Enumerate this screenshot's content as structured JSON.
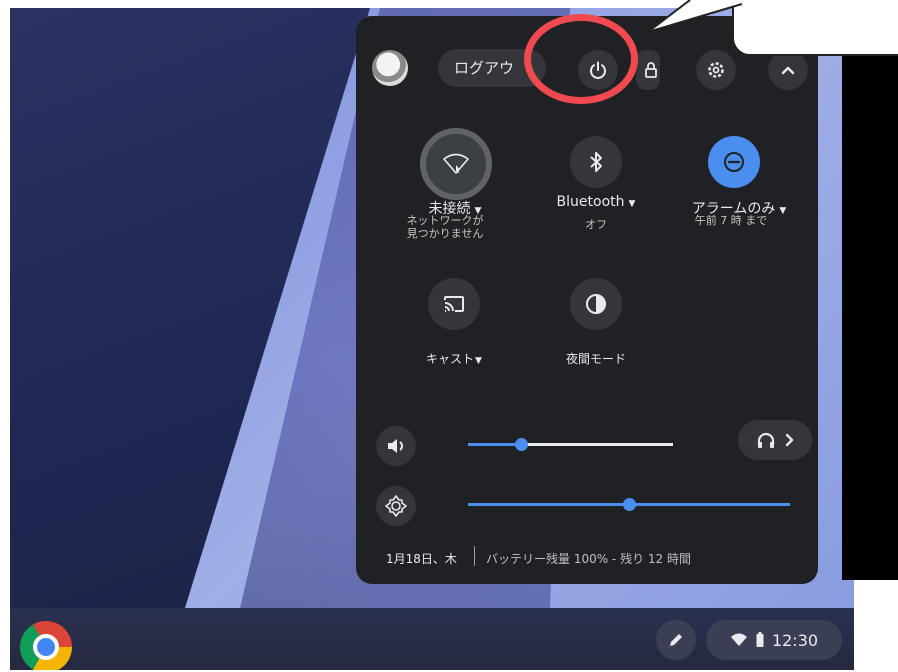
{
  "quick_settings": {
    "logout_label": "ログアウ",
    "network": {
      "label": "未接続",
      "detail": "ネットワークが\n見つかりません"
    },
    "bluetooth": {
      "label": "Bluetooth",
      "detail": "オフ"
    },
    "dnd": {
      "label": "アラームのみ",
      "detail": "午前 7 時 まで"
    },
    "cast": {
      "label": "キャスト"
    },
    "night_light": {
      "label": "夜間モード"
    },
    "volume_level": 0.26,
    "brightness_level": 0.5,
    "footer": {
      "date": "1月18日、木",
      "battery": "バッテリー残量 100% - 残り 12 時間"
    }
  },
  "shelf": {
    "time": "12:30"
  },
  "colors": {
    "accent": "#4a8ff0",
    "highlight_ring": "#f04a4f",
    "panel_bg": "#202124"
  },
  "icons": [
    "power-icon",
    "lock-icon",
    "gear-icon",
    "chevron-up-icon",
    "wifi-off-icon",
    "bluetooth-icon",
    "do-not-disturb-icon",
    "cast-icon",
    "night-light-icon",
    "volume-icon",
    "headphones-icon",
    "brightness-icon",
    "stylus-icon",
    "wifi-icon",
    "battery-icon",
    "chrome-icon"
  ]
}
